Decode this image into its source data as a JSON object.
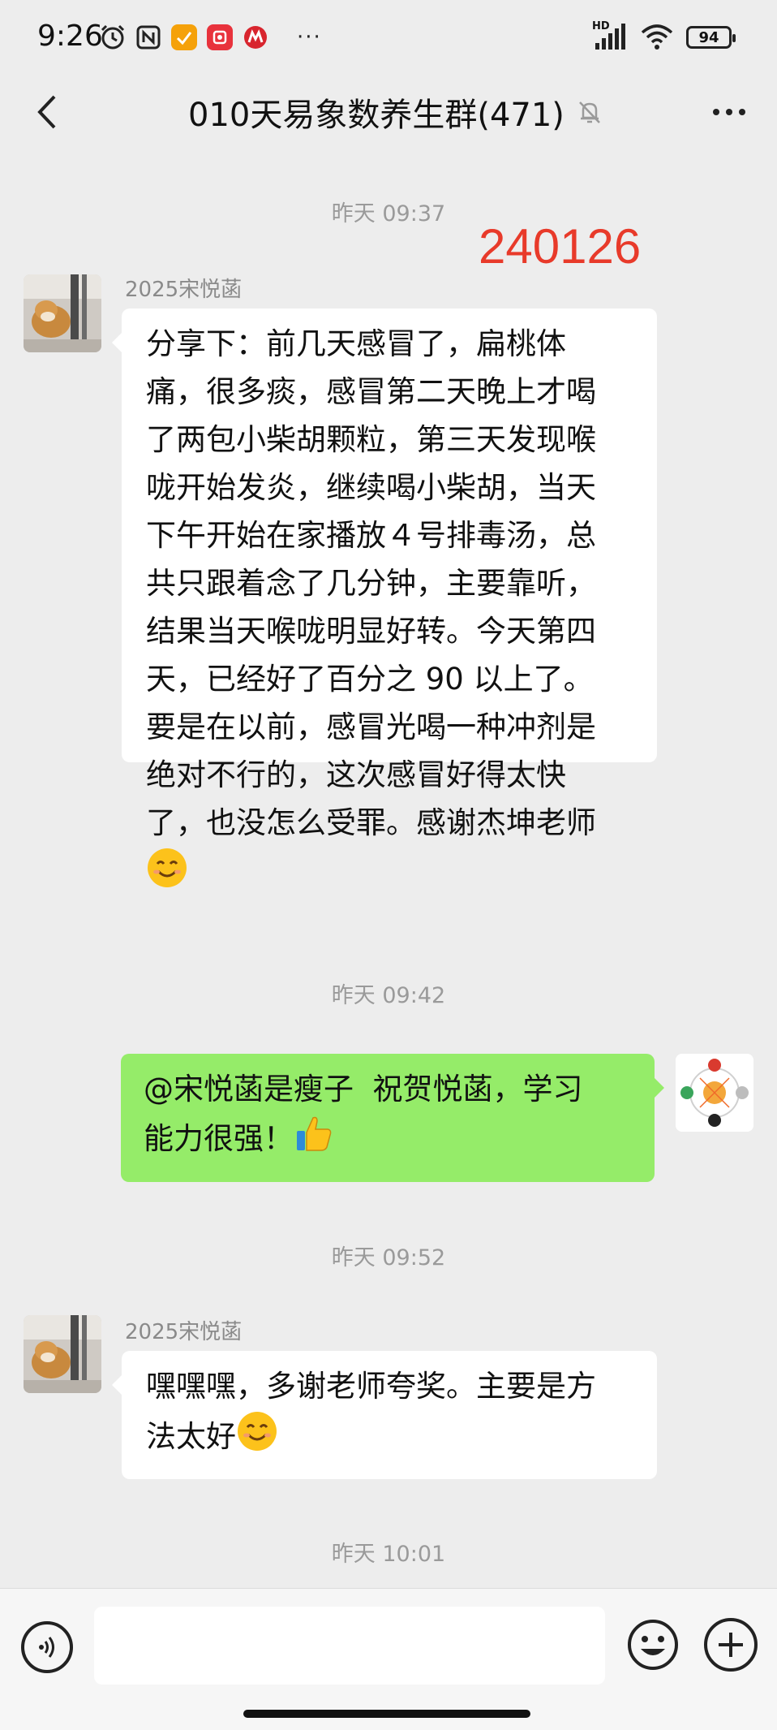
{
  "status_bar": {
    "time": "9:26",
    "network_label": "HD",
    "battery": "94",
    "icons": [
      "alarm-icon",
      "nfc-icon",
      "app-orange-icon",
      "app-red-icon",
      "app-metro-icon",
      "more-dots-icon",
      "signal-icon",
      "wifi-icon",
      "battery-icon"
    ],
    "more": "···"
  },
  "header": {
    "title": "010天易象数养生群(471)",
    "icons": [
      "back-icon",
      "mute-bell-icon",
      "more-icon"
    ]
  },
  "stamp": "240126",
  "messages": [
    {
      "type": "timestamp",
      "text": "昨天 09:37"
    },
    {
      "type": "message",
      "side": "left",
      "sender": "2025宋悦菡",
      "text": "分享下：前几天感冒了，扁桃体\n痛，很多痰，感冒第二天晚上才喝\n了两包小柴胡颗粒，第三天发现喉\n咙开始发炎，继续喝小柴胡，当天\n下午开始在家播放４号排毒汤，总\n共只跟着念了几分钟，主要靠听，\n结果当天喉咙明显好转。今天第四\n天，已经好了百分之 90 以上了。\n要是在以前，感冒光喝一种冲剂是\n绝对不行的，这次感冒好得太快\n了，也没怎么受罪。感谢杰坤老师\n",
      "emoji": "smile-emoji"
    },
    {
      "type": "timestamp",
      "text": "昨天 09:42"
    },
    {
      "type": "message",
      "side": "right",
      "text": "@宋悦菡是瘦子  祝贺悦菡，学习\n能力很强！",
      "emoji": "thumbs-up-emoji"
    },
    {
      "type": "timestamp",
      "text": "昨天 09:52"
    },
    {
      "type": "message",
      "side": "left",
      "sender": "2025宋悦菡",
      "text": "嘿嘿嘿，多谢老师夸奖。主要是方\n法太好",
      "emoji": "smile-emoji"
    },
    {
      "type": "timestamp",
      "text": "昨天 10:01"
    }
  ],
  "input_bar": {
    "placeholder": "",
    "value": ""
  },
  "colors": {
    "background": "#ededed",
    "own_bubble": "#95ec69",
    "other_bubble": "#ffffff",
    "stamp": "#e83a2a"
  }
}
